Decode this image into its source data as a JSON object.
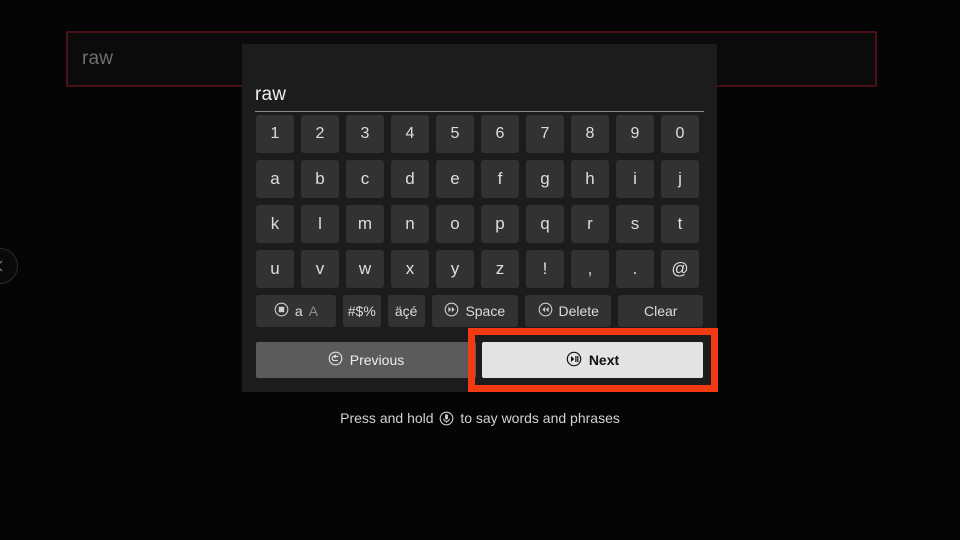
{
  "background": {
    "search_field": {
      "value": "raw",
      "border_color": "#4a1117"
    },
    "edge_nav_icon": "chevron-left-icon"
  },
  "keyboard": {
    "input_value": "raw",
    "rows": [
      [
        "1",
        "2",
        "3",
        "4",
        "5",
        "6",
        "7",
        "8",
        "9",
        "0"
      ],
      [
        "a",
        "b",
        "c",
        "d",
        "e",
        "f",
        "g",
        "h",
        "i",
        "j"
      ],
      [
        "k",
        "l",
        "m",
        "n",
        "o",
        "p",
        "q",
        "r",
        "s",
        "t"
      ],
      [
        "u",
        "v",
        "w",
        "x",
        "y",
        "z",
        "!",
        ",",
        ".",
        "@"
      ]
    ],
    "function_keys": {
      "shift_lower": "a",
      "shift_upper": "A",
      "shift_icon": "remote-select-icon",
      "symbols": "#$%",
      "accents": "äçé",
      "space": "Space",
      "space_icon": "remote-fastforward-icon",
      "delete": "Delete",
      "delete_icon": "remote-rewind-icon",
      "clear": "Clear"
    },
    "nav": {
      "previous": "Previous",
      "previous_icon": "remote-back-icon",
      "next": "Next",
      "next_icon": "remote-playpause-icon"
    }
  },
  "hint": {
    "before": "Press and hold",
    "icon": "microphone-icon",
    "after": "to say words and phrases"
  },
  "annotation": {
    "highlight_color": "#f33a12",
    "target": "next-button"
  }
}
